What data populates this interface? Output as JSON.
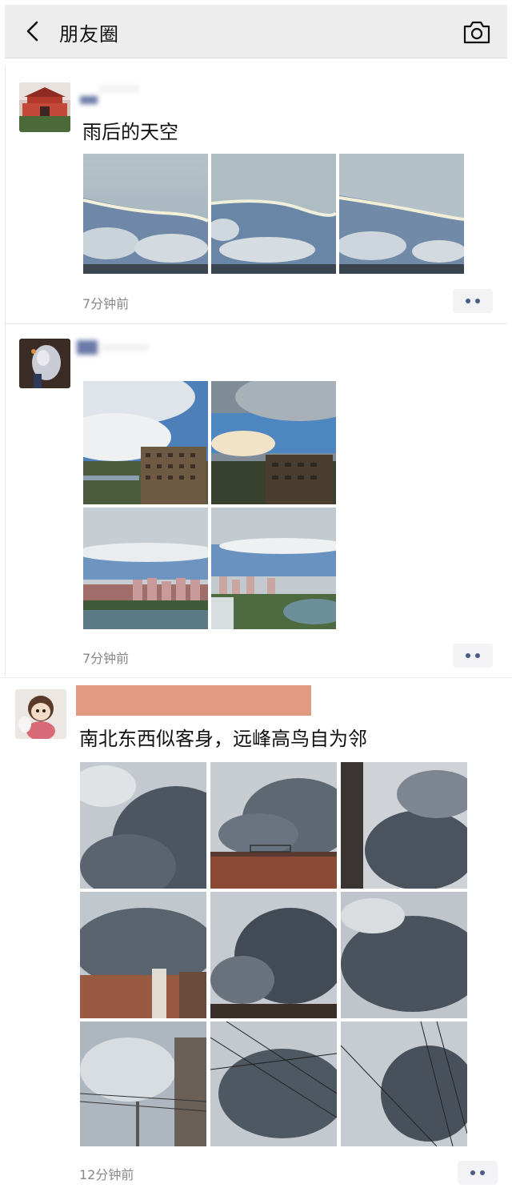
{
  "header": {
    "title": "朋友圈",
    "back_icon": "chevron-left-icon",
    "camera_icon": "camera-icon",
    "background": "#ededed"
  },
  "posts": [
    {
      "caption": "雨后的天空",
      "time": "7分钟前",
      "image_count": 3
    },
    {
      "caption": "",
      "time": "7分钟前",
      "image_count": 4
    },
    {
      "caption": "南北东西似客身，远峰高鸟自为邻",
      "time": "12分钟前",
      "image_count": 9
    }
  ],
  "colors": {
    "more_dots": "#4a5b86",
    "name_redaction": "#e19b80",
    "time_text": "#888888"
  }
}
